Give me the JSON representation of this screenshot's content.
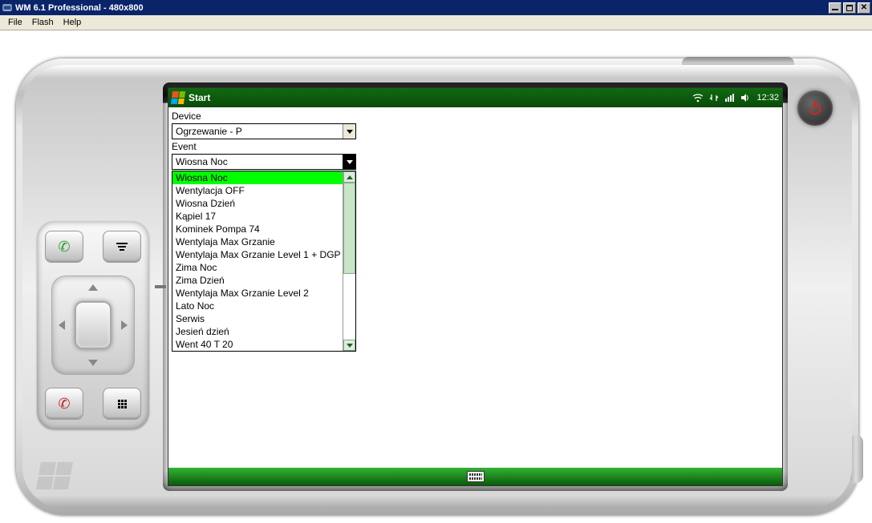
{
  "window": {
    "title": "WM 6.1 Professional - 480x800"
  },
  "menubar": {
    "items": [
      "File",
      "Flash",
      "Help"
    ]
  },
  "wm": {
    "start_label": "Start",
    "clock": "12:32"
  },
  "device_field": {
    "label": "Device",
    "value": "Ogrzewanie - P"
  },
  "event_field": {
    "label": "Event",
    "value": "Wiosna Noc",
    "options": [
      "Wiosna Noc",
      "Wentylacja OFF",
      "Wiosna Dzień",
      "Kąpiel 17",
      "Kominek Pompa 74",
      "Wentylaja Max Grzanie",
      "Wentylaja Max Grzanie Level 1 + DGP",
      "Zima Noc",
      "Zima Dzień",
      "Wentylaja Max Grzanie Level 2",
      "Lato Noc",
      "Serwis",
      "Jesień dzień",
      "Went 40 T 20"
    ],
    "selected_index": 0
  }
}
